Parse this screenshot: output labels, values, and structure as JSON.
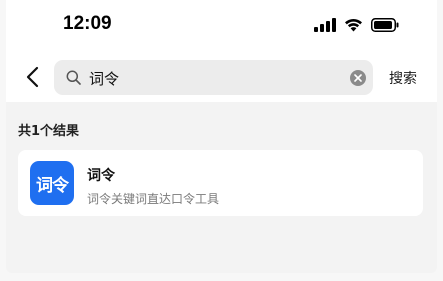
{
  "status_bar": {
    "time": "12:09"
  },
  "search": {
    "value": "词令",
    "action_label": "搜索"
  },
  "results": {
    "count_label": "共1个结果",
    "items": [
      {
        "icon_text": "词令",
        "icon_color": "#1f6ff0",
        "name": "词令",
        "description": "词令关键词直达口令工具"
      }
    ]
  },
  "icons": {
    "back": "chevron-left-icon",
    "search": "search-icon",
    "clear": "clear-icon",
    "signal": "signal-icon",
    "wifi": "wifi-icon",
    "battery": "battery-icon"
  }
}
